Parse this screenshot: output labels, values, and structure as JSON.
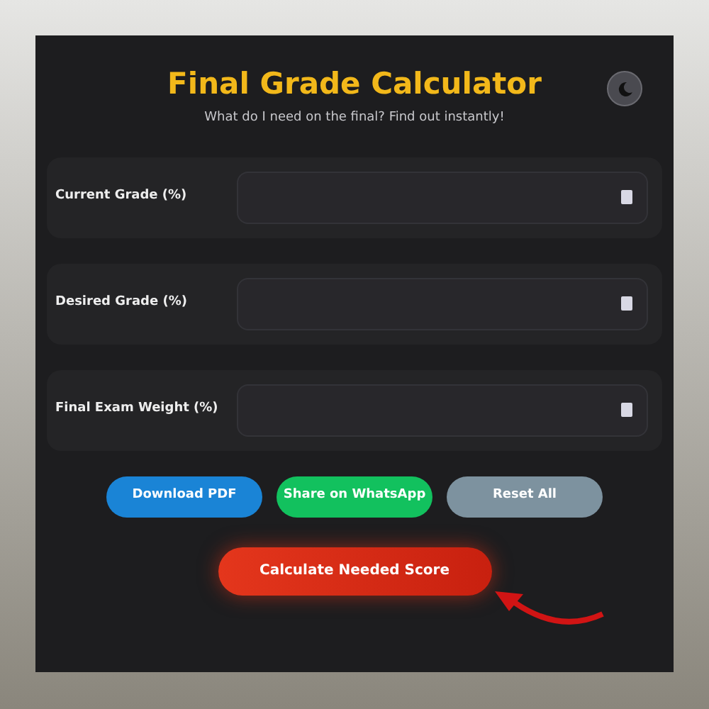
{
  "header": {
    "title": "Final Grade Calculator",
    "subtitle": "What do I need on the final? Find out instantly!"
  },
  "fields": [
    {
      "label": "Current Grade (%)"
    },
    {
      "label": "Desired Grade (%)"
    },
    {
      "label": "Final Exam Weight (%)"
    }
  ],
  "actions": [
    {
      "label": "Download PDF",
      "color": "#1a84d6"
    },
    {
      "label": "Share on WhatsApp",
      "color": "#12c15e"
    },
    {
      "label": "Reset All",
      "color": "#7d929f"
    }
  ],
  "primary": {
    "label": "Calculate Needed Score"
  }
}
